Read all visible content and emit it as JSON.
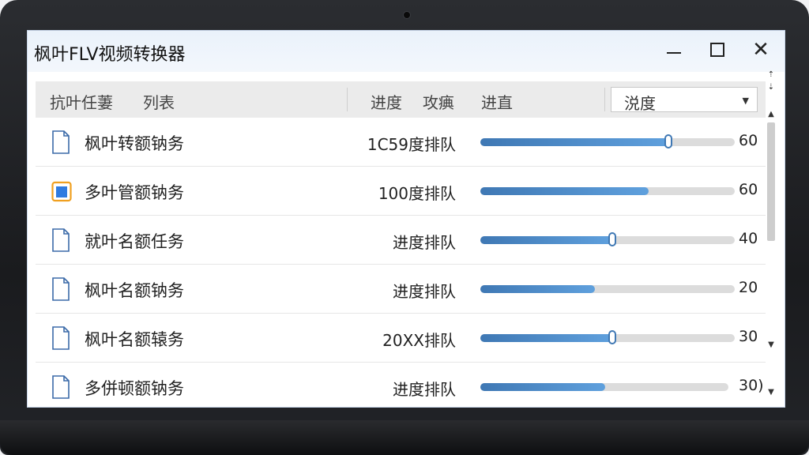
{
  "window": {
    "title": "枫叶FLV视频转换器",
    "close_glyph": "✕"
  },
  "toolbar": {
    "col_task": "抗叶任萋",
    "col_list": "列表",
    "col_progress": "进度",
    "col_speed": "攻痶",
    "col_status": "进直",
    "select_value": "涚度",
    "select_caret": "▼"
  },
  "rows": [
    {
      "name": "枫叶转额钠务",
      "status": "1C59度排队",
      "progress": 60,
      "pct_label": "60",
      "thumb": true,
      "icon": "document-icon"
    },
    {
      "name": "多叶管额钠务",
      "status": "100度排队",
      "progress": 60,
      "pct_label": "60",
      "thumb": false,
      "icon": "folder-icon"
    },
    {
      "name": "就叶名额任务",
      "status": "进度排队",
      "progress": 40,
      "pct_label": "40",
      "thumb": true,
      "icon": "document-icon"
    },
    {
      "name": "枫叶名额钠务",
      "status": "进度排队",
      "progress": 20,
      "pct_label": "20",
      "thumb": false,
      "icon": "document-icon"
    },
    {
      "name": "枫叶名额辕务",
      "status": "20XX排队",
      "progress": 30,
      "pct_label": "30",
      "thumb": true,
      "icon": "document-icon"
    },
    {
      "name": "多併顿额钠务",
      "status": "进度排队",
      "progress": 30,
      "pct_label": "30)",
      "thumb": false,
      "icon": "document-icon"
    }
  ],
  "scrollbar": {
    "up": "▲",
    "down": "▼",
    "top_up": "⇡",
    "top_down": "⇣"
  },
  "colors": {
    "accent": "#3f78b4",
    "folder": "#f0a020",
    "folder_fill": "#2f7be0"
  }
}
